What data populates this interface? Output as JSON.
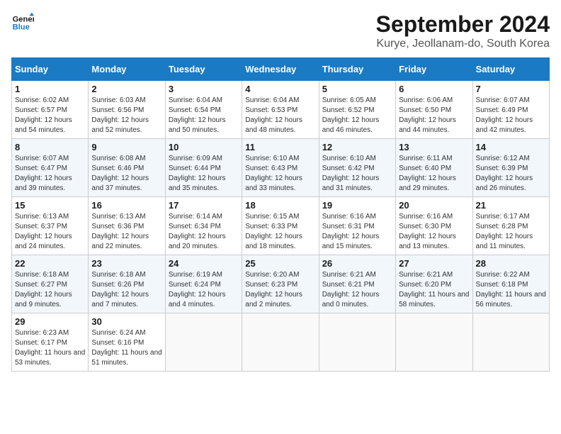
{
  "header": {
    "logo_line1": "General",
    "logo_line2": "Blue",
    "title": "September 2024",
    "subtitle": "Kurye, Jeollanam-do, South Korea"
  },
  "weekdays": [
    "Sunday",
    "Monday",
    "Tuesday",
    "Wednesday",
    "Thursday",
    "Friday",
    "Saturday"
  ],
  "weeks": [
    [
      {
        "day": "1",
        "sunrise": "6:02 AM",
        "sunset": "6:57 PM",
        "daylight": "12 hours and 54 minutes."
      },
      {
        "day": "2",
        "sunrise": "6:03 AM",
        "sunset": "6:56 PM",
        "daylight": "12 hours and 52 minutes."
      },
      {
        "day": "3",
        "sunrise": "6:04 AM",
        "sunset": "6:54 PM",
        "daylight": "12 hours and 50 minutes."
      },
      {
        "day": "4",
        "sunrise": "6:04 AM",
        "sunset": "6:53 PM",
        "daylight": "12 hours and 48 minutes."
      },
      {
        "day": "5",
        "sunrise": "6:05 AM",
        "sunset": "6:52 PM",
        "daylight": "12 hours and 46 minutes."
      },
      {
        "day": "6",
        "sunrise": "6:06 AM",
        "sunset": "6:50 PM",
        "daylight": "12 hours and 44 minutes."
      },
      {
        "day": "7",
        "sunrise": "6:07 AM",
        "sunset": "6:49 PM",
        "daylight": "12 hours and 42 minutes."
      }
    ],
    [
      {
        "day": "8",
        "sunrise": "6:07 AM",
        "sunset": "6:47 PM",
        "daylight": "12 hours and 39 minutes."
      },
      {
        "day": "9",
        "sunrise": "6:08 AM",
        "sunset": "6:46 PM",
        "daylight": "12 hours and 37 minutes."
      },
      {
        "day": "10",
        "sunrise": "6:09 AM",
        "sunset": "6:44 PM",
        "daylight": "12 hours and 35 minutes."
      },
      {
        "day": "11",
        "sunrise": "6:10 AM",
        "sunset": "6:43 PM",
        "daylight": "12 hours and 33 minutes."
      },
      {
        "day": "12",
        "sunrise": "6:10 AM",
        "sunset": "6:42 PM",
        "daylight": "12 hours and 31 minutes."
      },
      {
        "day": "13",
        "sunrise": "6:11 AM",
        "sunset": "6:40 PM",
        "daylight": "12 hours and 29 minutes."
      },
      {
        "day": "14",
        "sunrise": "6:12 AM",
        "sunset": "6:39 PM",
        "daylight": "12 hours and 26 minutes."
      }
    ],
    [
      {
        "day": "15",
        "sunrise": "6:13 AM",
        "sunset": "6:37 PM",
        "daylight": "12 hours and 24 minutes."
      },
      {
        "day": "16",
        "sunrise": "6:13 AM",
        "sunset": "6:36 PM",
        "daylight": "12 hours and 22 minutes."
      },
      {
        "day": "17",
        "sunrise": "6:14 AM",
        "sunset": "6:34 PM",
        "daylight": "12 hours and 20 minutes."
      },
      {
        "day": "18",
        "sunrise": "6:15 AM",
        "sunset": "6:33 PM",
        "daylight": "12 hours and 18 minutes."
      },
      {
        "day": "19",
        "sunrise": "6:16 AM",
        "sunset": "6:31 PM",
        "daylight": "12 hours and 15 minutes."
      },
      {
        "day": "20",
        "sunrise": "6:16 AM",
        "sunset": "6:30 PM",
        "daylight": "12 hours and 13 minutes."
      },
      {
        "day": "21",
        "sunrise": "6:17 AM",
        "sunset": "6:28 PM",
        "daylight": "12 hours and 11 minutes."
      }
    ],
    [
      {
        "day": "22",
        "sunrise": "6:18 AM",
        "sunset": "6:27 PM",
        "daylight": "12 hours and 9 minutes."
      },
      {
        "day": "23",
        "sunrise": "6:18 AM",
        "sunset": "6:26 PM",
        "daylight": "12 hours and 7 minutes."
      },
      {
        "day": "24",
        "sunrise": "6:19 AM",
        "sunset": "6:24 PM",
        "daylight": "12 hours and 4 minutes."
      },
      {
        "day": "25",
        "sunrise": "6:20 AM",
        "sunset": "6:23 PM",
        "daylight": "12 hours and 2 minutes."
      },
      {
        "day": "26",
        "sunrise": "6:21 AM",
        "sunset": "6:21 PM",
        "daylight": "12 hours and 0 minutes."
      },
      {
        "day": "27",
        "sunrise": "6:21 AM",
        "sunset": "6:20 PM",
        "daylight": "11 hours and 58 minutes."
      },
      {
        "day": "28",
        "sunrise": "6:22 AM",
        "sunset": "6:18 PM",
        "daylight": "11 hours and 56 minutes."
      }
    ],
    [
      {
        "day": "29",
        "sunrise": "6:23 AM",
        "sunset": "6:17 PM",
        "daylight": "11 hours and 53 minutes."
      },
      {
        "day": "30",
        "sunrise": "6:24 AM",
        "sunset": "6:16 PM",
        "daylight": "11 hours and 51 minutes."
      },
      null,
      null,
      null,
      null,
      null
    ]
  ]
}
